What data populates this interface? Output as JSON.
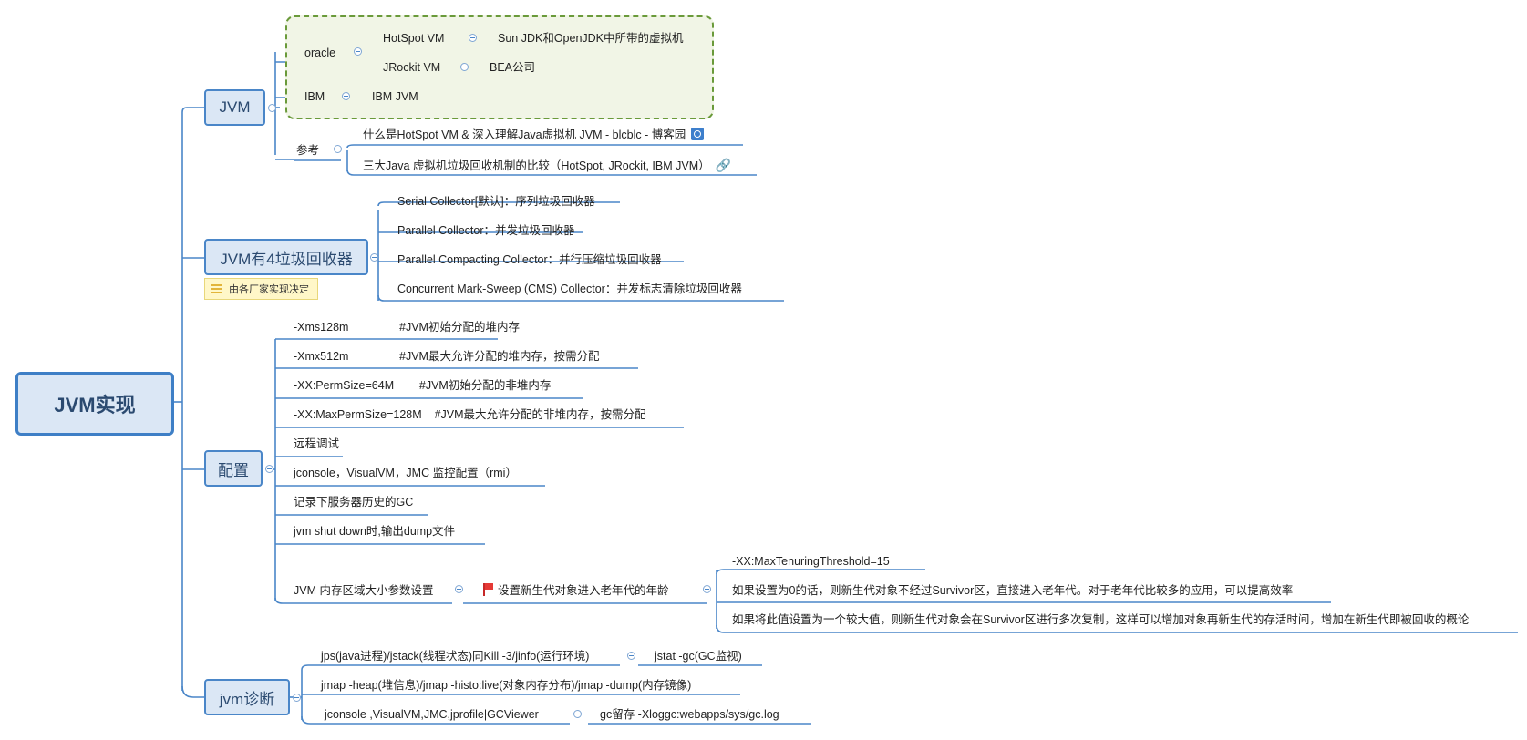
{
  "root": {
    "label": "JVM实现"
  },
  "colors": {
    "line": "#4a86c8",
    "topic_fill": "#dbe7f5",
    "group_border": "#6a9a3a",
    "group_fill": "#f1f5e6",
    "note_fill": "#fff7c8"
  },
  "branches": {
    "jvm": {
      "label": "JVM",
      "oracle": {
        "label": "oracle",
        "hotspot": {
          "label": "HotSpot VM",
          "child": "Sun JDK和OpenJDK中所带的虚拟机"
        },
        "jrockit": {
          "label": "JRockit VM",
          "child": "BEA公司"
        }
      },
      "ibm": {
        "label": "IBM",
        "child": "IBM JVM"
      },
      "reference": {
        "label": "参考",
        "items": [
          "什么是HotSpot VM & 深入理解Java虚拟机 JVM - blcblc - 博客园",
          "三大Java 虚拟机垃圾回收机制的比较（HotSpot, JRockit, IBM JVM）"
        ]
      }
    },
    "gc": {
      "label": "JVM有4垃圾回收器",
      "note": "由各厂家实现决定",
      "items": [
        "Serial Collector[默认]：序列垃圾回收器",
        "Parallel Collector：并发垃圾回收器",
        "Parallel Compacting Collector：并行压缩垃圾回收器",
        "Concurrent Mark-Sweep (CMS) Collector：并发标志清除垃圾回收器"
      ]
    },
    "config": {
      "label": "配置",
      "items": [
        "-Xms128m                #JVM初始分配的堆内存",
        "-Xmx512m                #JVM最大允许分配的堆内存，按需分配",
        "-XX:PermSize=64M        #JVM初始分配的非堆内存",
        "-XX:MaxPermSize=128M    #JVM最大允许分配的非堆内存，按需分配",
        "远程调试",
        "jconsole，VisualVM，JMC 监控配置（rmi）",
        "记录下服务器历史的GC",
        "jvm shut down时,输出dump文件"
      ],
      "memory": {
        "label": "JVM 内存区域大小参数设置",
        "age": {
          "label": "设置新生代对象进入老年代的年龄",
          "items": [
            "-XX:MaxTenuringThreshold=15",
            "如果设置为0的话，则新生代对象不经过Survivor区，直接进入老年代。对于老年代比较多的应用，可以提高效率",
            "如果将此值设置为一个较大值，则新生代对象会在Survivor区进行多次复制，这样可以增加对象再新生代的存活时间，增加在新生代即被回收的概论"
          ]
        }
      }
    },
    "diag": {
      "label": "jvm诊断",
      "items": [
        {
          "label": "jps(java进程)/jstack(线程状态)同Kill -3/jinfo(运行环境)",
          "child": "jstat -gc(GC监视)"
        },
        {
          "label": "jmap -heap(堆信息)/jmap -histo:live(对象内存分布)/jmap -dump(内存镜像)"
        },
        {
          "label": "jconsole ,VisualVM,JMC,jprofile|GCViewer",
          "child": "gc留存 -Xloggc:webapps/sys/gc.log"
        }
      ]
    }
  }
}
